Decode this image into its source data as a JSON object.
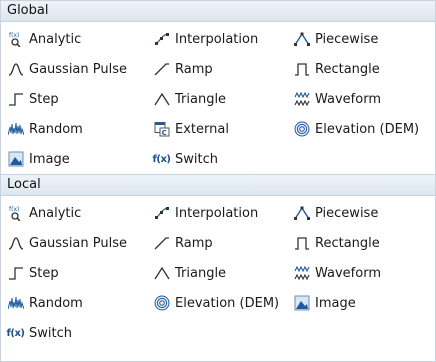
{
  "sections": [
    {
      "title": "Global",
      "items": [
        {
          "label": "Analytic",
          "icon": "analytic-icon"
        },
        {
          "label": "Interpolation",
          "icon": "interpolation-icon"
        },
        {
          "label": "Piecewise",
          "icon": "piecewise-icon"
        },
        {
          "label": "Gaussian Pulse",
          "icon": "gaussian-pulse-icon"
        },
        {
          "label": "Ramp",
          "icon": "ramp-icon"
        },
        {
          "label": "Rectangle",
          "icon": "rectangle-icon"
        },
        {
          "label": "Step",
          "icon": "step-icon"
        },
        {
          "label": "Triangle",
          "icon": "triangle-icon"
        },
        {
          "label": "Waveform",
          "icon": "waveform-icon"
        },
        {
          "label": "Random",
          "icon": "random-icon"
        },
        {
          "label": "External",
          "icon": "external-icon"
        },
        {
          "label": "Elevation (DEM)",
          "icon": "elevation-icon"
        },
        {
          "label": "Image",
          "icon": "image-icon"
        },
        {
          "label": "Switch",
          "icon": "switch-icon"
        }
      ]
    },
    {
      "title": "Local",
      "items": [
        {
          "label": "Analytic",
          "icon": "analytic-icon"
        },
        {
          "label": "Interpolation",
          "icon": "interpolation-icon"
        },
        {
          "label": "Piecewise",
          "icon": "piecewise-icon"
        },
        {
          "label": "Gaussian Pulse",
          "icon": "gaussian-pulse-icon"
        },
        {
          "label": "Ramp",
          "icon": "ramp-icon"
        },
        {
          "label": "Rectangle",
          "icon": "rectangle-icon"
        },
        {
          "label": "Step",
          "icon": "step-icon"
        },
        {
          "label": "Triangle",
          "icon": "triangle-icon"
        },
        {
          "label": "Waveform",
          "icon": "waveform-icon"
        },
        {
          "label": "Random",
          "icon": "random-icon"
        },
        {
          "label": "Elevation (DEM)",
          "icon": "elevation-icon"
        },
        {
          "label": "Image",
          "icon": "image-icon"
        },
        {
          "label": "Switch",
          "icon": "switch-icon"
        }
      ]
    }
  ],
  "icon_glyph_text": {
    "switch": "f(x)",
    "analytic": "f(x)"
  },
  "colors": {
    "header_bg": "#e4ebf2",
    "border": "#c9d3de",
    "icon_blue": "#1f5a9e"
  }
}
